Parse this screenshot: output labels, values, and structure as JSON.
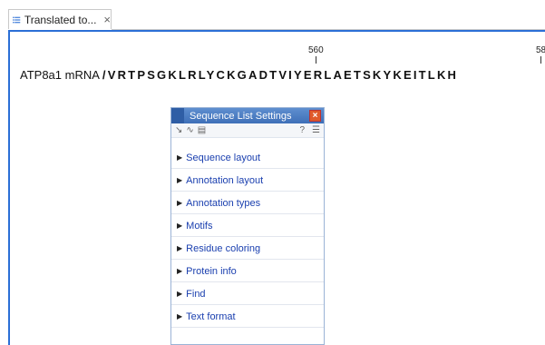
{
  "tab": {
    "icon": "list-icon",
    "label": "Translated to...",
    "close": "×"
  },
  "ruler": {
    "label_560": "560",
    "label_58x": "58"
  },
  "sequence": {
    "name": "ATP8a1 mRNA",
    "residues": "/VRTPSGKLRLYCKGADTVIYERLAETSKYKEITLKH"
  },
  "panel": {
    "title": "Sequence List Settings",
    "close": "×",
    "toolbar_left_icons": [
      "pointer-icon",
      "wave-icon",
      "table-icon"
    ],
    "help": "?",
    "menu_icon": "menu-icon",
    "sections": [
      "Sequence layout",
      "Annotation layout",
      "Annotation types",
      "Motifs",
      "Residue coloring",
      "Protein info",
      "Find",
      "Text format"
    ]
  },
  "colors": {
    "accent": "#2b6fd6",
    "panel_title": "#3e6fb8",
    "section_text": "#1a3faf"
  }
}
